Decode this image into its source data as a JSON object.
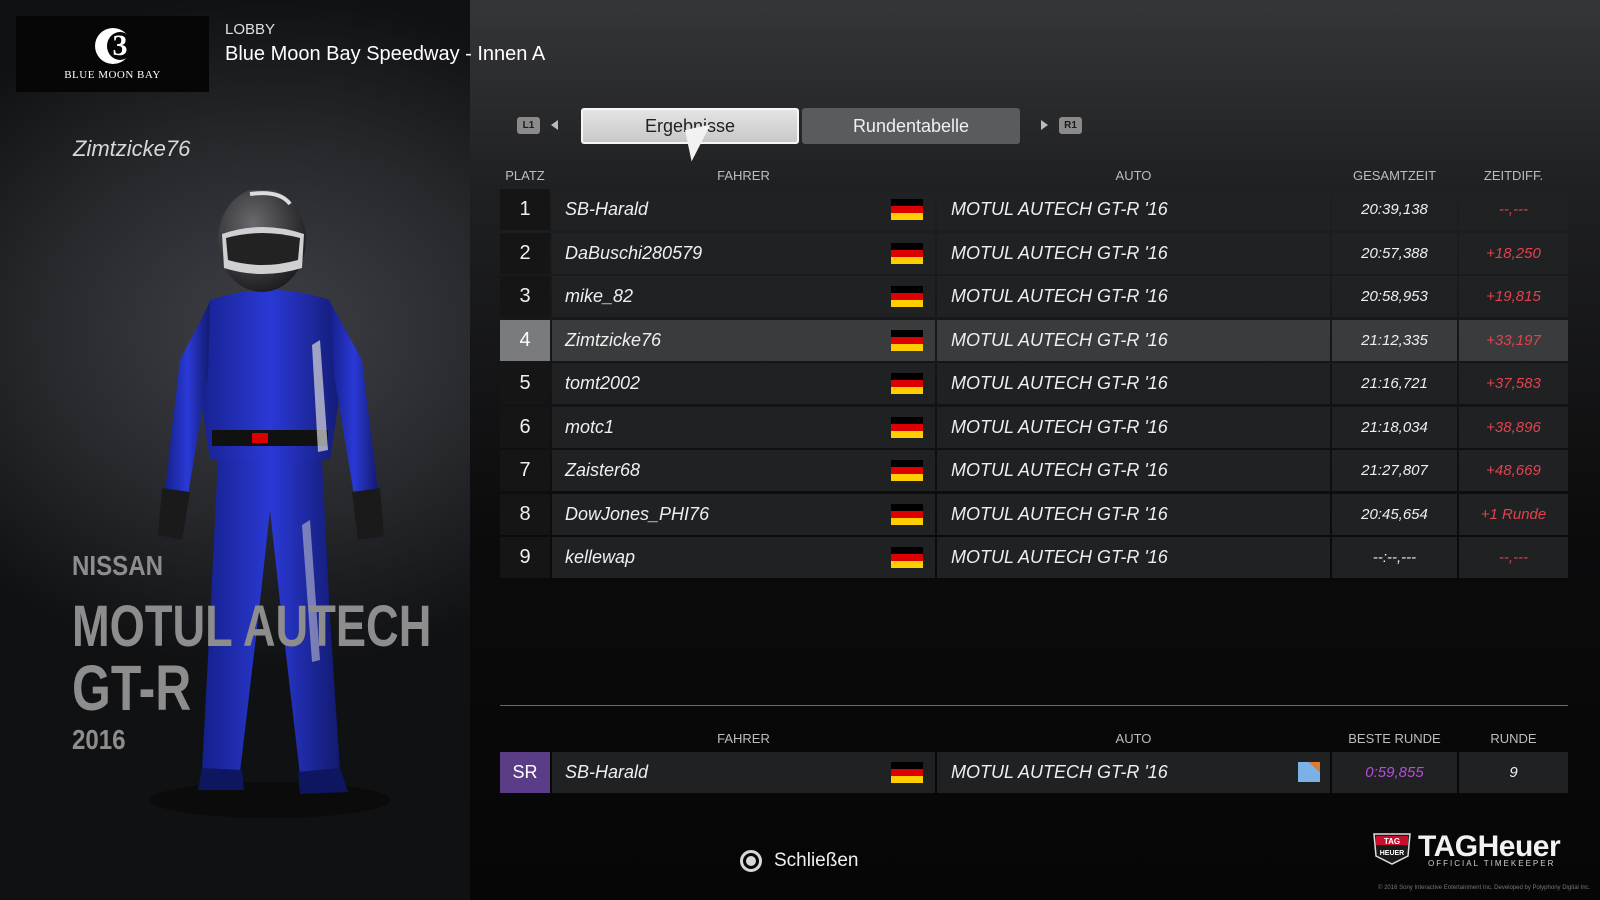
{
  "header": {
    "logo_text": "BLUE MOON BAY",
    "logo_digit": "3",
    "section": "LOBBY",
    "track": "Blue Moon Bay Speedway - Innen A"
  },
  "player": {
    "name": "Zimtzicke76"
  },
  "car": {
    "make": "NISSAN",
    "model_line1": "MOTUL AUTECH",
    "model_line2": "GT-R",
    "year": "2016"
  },
  "tabs": {
    "left_shoulder": "L1",
    "right_shoulder": "R1",
    "items": [
      {
        "label": "Ergebnisse",
        "active": true
      },
      {
        "label": "Rundentabelle",
        "active": false
      }
    ]
  },
  "results": {
    "columns": {
      "position": "PLATZ",
      "driver": "FAHRER",
      "car": "AUTO",
      "total": "GESAMTZEIT",
      "diff": "ZEITDIFF."
    },
    "rows": [
      {
        "pos": "1",
        "driver": "SB-Harald",
        "car": "MOTUL AUTECH GT-R '16",
        "total": "20:39,138",
        "diff": "--,---"
      },
      {
        "pos": "2",
        "driver": "DaBuschi280579",
        "car": "MOTUL AUTECH GT-R '16",
        "total": "20:57,388",
        "diff": "+18,250"
      },
      {
        "pos": "3",
        "driver": "mike_82",
        "car": "MOTUL AUTECH GT-R '16",
        "total": "20:58,953",
        "diff": "+19,815"
      },
      {
        "pos": "4",
        "driver": "Zimtzicke76",
        "car": "MOTUL AUTECH GT-R '16",
        "total": "21:12,335",
        "diff": "+33,197"
      },
      {
        "pos": "5",
        "driver": "tomt2002",
        "car": "MOTUL AUTECH GT-R '16",
        "total": "21:16,721",
        "diff": "+37,583"
      },
      {
        "pos": "6",
        "driver": "motc1",
        "car": "MOTUL AUTECH GT-R '16",
        "total": "21:18,034",
        "diff": "+38,896"
      },
      {
        "pos": "7",
        "driver": "Zaister68",
        "car": "MOTUL AUTECH GT-R '16",
        "total": "21:27,807",
        "diff": "+48,669"
      },
      {
        "pos": "8",
        "driver": "DowJones_PHI76",
        "car": "MOTUL AUTECH GT-R '16",
        "total": "20:45,654",
        "diff": "+1 Runde"
      },
      {
        "pos": "9",
        "driver": "kellewap",
        "car": "MOTUL AUTECH GT-R '16",
        "total": "--:--,---",
        "diff": "--,---"
      }
    ],
    "highlight_index": 3,
    "flag": "flag-germany-icon",
    "flag_colors": [
      "#000000",
      "#dd0000",
      "#ffce00"
    ]
  },
  "best_lap": {
    "columns": {
      "driver": "FAHRER",
      "car": "AUTO",
      "best": "BESTE RUNDE",
      "lap": "RUNDE"
    },
    "badge": "SR",
    "driver": "SB-Harald",
    "car": "MOTUL AUTECH GT-R '16",
    "time": "0:59,855",
    "lap": "9",
    "tyre_icon": "tyre-compound-icon"
  },
  "footer": {
    "close_label": "Schließen",
    "close_icon": "circle-button-icon",
    "sponsor_name": "TAGHeuer",
    "sponsor_badge_top": "TAG",
    "sponsor_badge_bottom": "HEUER",
    "sponsor_sub": "OFFICIAL TIMEKEEPER",
    "copyright": "© 2016 Sony Interactive Entertainment Inc. Developed by Polyphony Digital Inc."
  },
  "colors": {
    "accent_red": "#e0434e",
    "best_lap_purple": "#b44fd8",
    "sr_badge": "#5a3d86"
  }
}
